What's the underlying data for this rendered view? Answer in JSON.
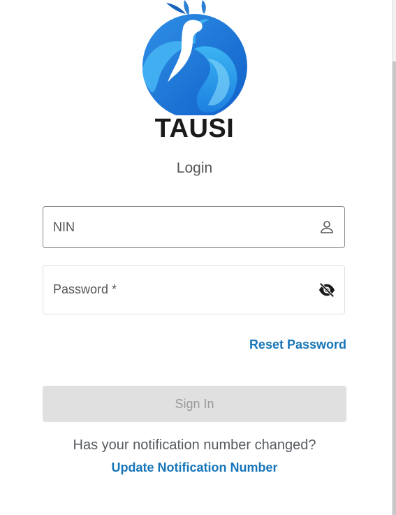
{
  "brand": {
    "name": "TAUSI"
  },
  "page": {
    "title": "Login"
  },
  "form": {
    "nin_placeholder": "NIN",
    "password_placeholder": "Password *",
    "reset_password_label": "Reset Password",
    "sign_in_label": "Sign In",
    "sign_in_enabled": false
  },
  "footer": {
    "question": "Has your notification number changed?",
    "update_link_label": "Update Notification Number"
  },
  "icons": {
    "logo": "peacock-logo-icon",
    "nin_field": "person-icon",
    "password_field": "eye-off-icon"
  },
  "colors": {
    "brand_blue": "#1e90e6",
    "link_blue": "#1675b8",
    "button_disabled_bg": "#e0e0e0",
    "button_disabled_text": "#9a9a9a"
  }
}
